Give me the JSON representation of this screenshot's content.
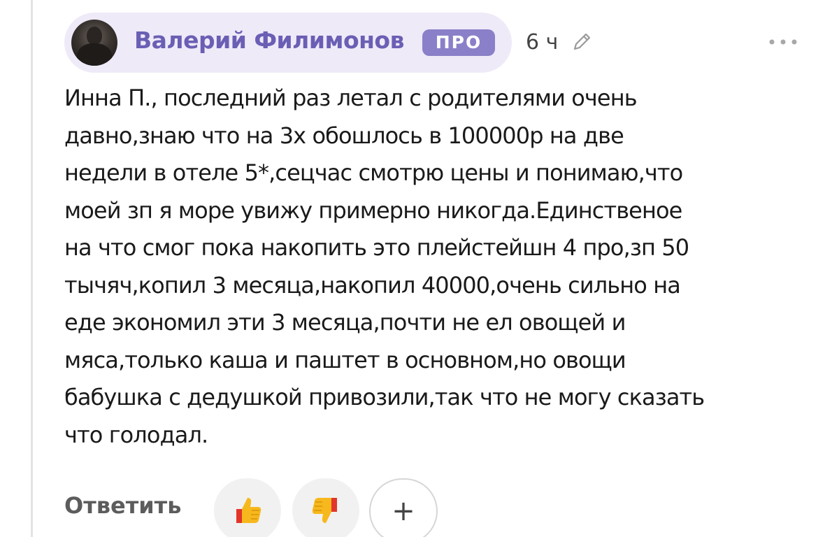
{
  "comment": {
    "author": {
      "name": "Валерий Филимонов",
      "badge": "ПРО",
      "avatar_icon": "user-avatar-photo"
    },
    "time_ago": "6 ч",
    "edit_icon": "pencil-icon",
    "menu_icon": "more-horizontal-icon",
    "text_lines": [
      "Инна П., последний раз летал с родителями очень",
      "давно,знаю что на 3х обошлось в 100000р на две",
      "недели в отеле 5*,сецчас смотрю цены и понимаю,что",
      "моей зп я море увижу примерно никогда.Единственое",
      "на что смог пока накопить это плейстейшн 4 про,зп 50",
      "тычяч,копил 3 месяца,накопил 40000,очень сильно на",
      "еде экономил эти 3 месяца,почти не ел овощей и",
      "мяса,только каша и паштет в основном,но овощи",
      "бабушка с дедушкой привозили,так что не могу сказать",
      "что голодал."
    ]
  },
  "actions": {
    "reply_label": "Ответить",
    "like_icon": "thumbs-up-emoji",
    "dislike_icon": "thumbs-down-emoji",
    "add_reaction_label": "+"
  },
  "colors": {
    "author_name": "#6a5fb4",
    "badge_bg": "#8a80c9",
    "chip_bg": "#efeaf8",
    "reaction_bg": "#f1f1f1",
    "thumb_yellow": "#f6b81c",
    "thumb_red": "#e2362b"
  }
}
